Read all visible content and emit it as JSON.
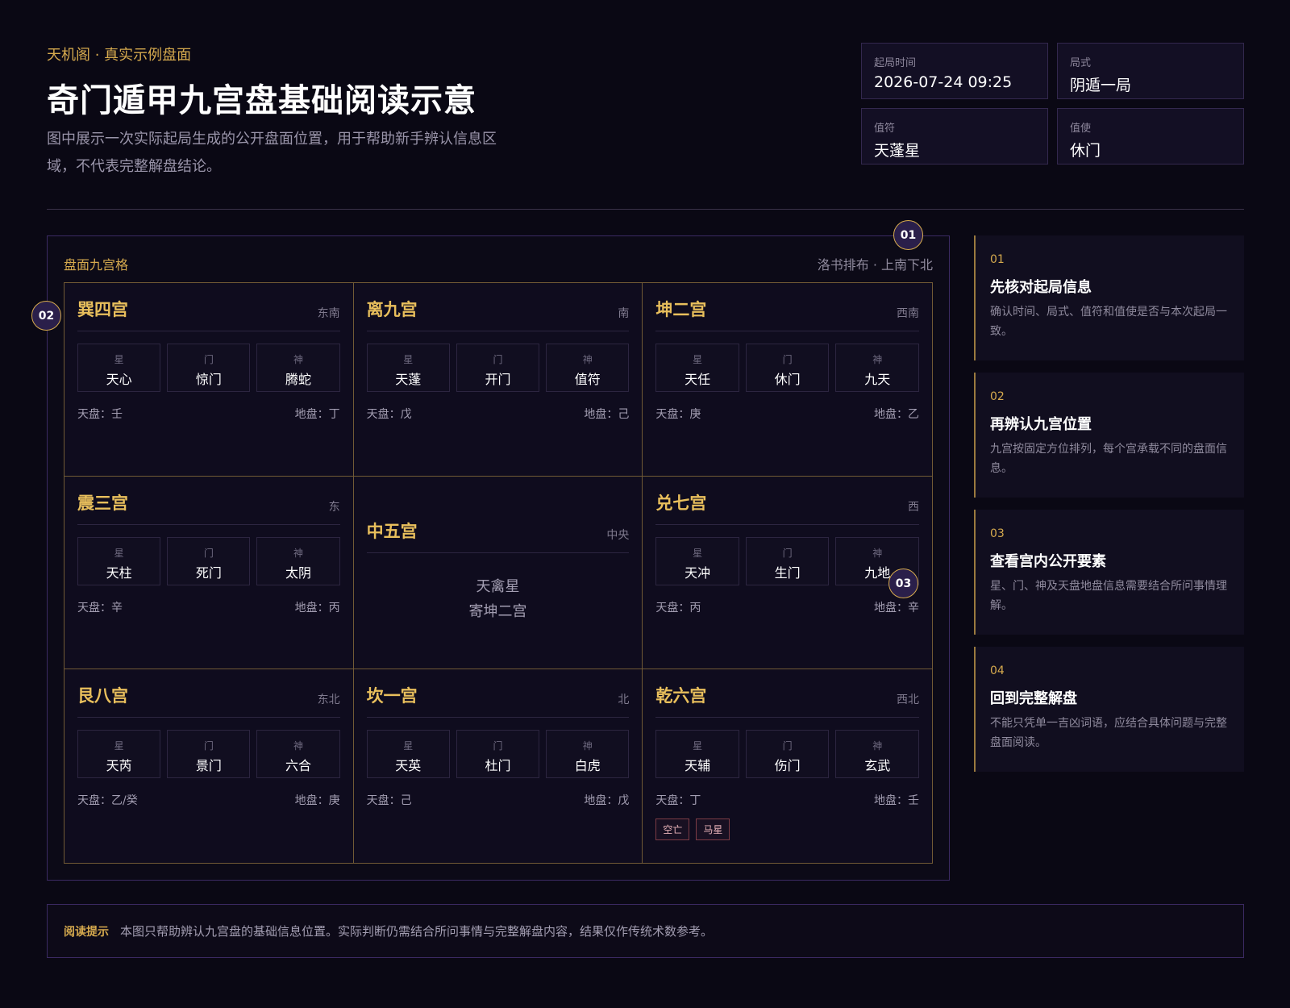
{
  "header": {
    "kicker": "天机阁 · 真实示例盘面",
    "title": "奇门遁甲九宫盘基础阅读示意",
    "subtitle": "图中展示一次实际起局生成的公开盘面位置，用于帮助新手辨认信息区域，不代表完整解盘结论。"
  },
  "meta": [
    {
      "label": "起局时间",
      "value": "2026-07-24 09:25"
    },
    {
      "label": "局式",
      "value": "阴遁一局"
    },
    {
      "label": "值符",
      "value": "天蓬星"
    },
    {
      "label": "值使",
      "value": "休门"
    }
  ],
  "board": {
    "title": "盘面九宫格",
    "layout": "洛书排布 · 上南下北",
    "labels": {
      "star": "星",
      "gate": "门",
      "god": "神",
      "tian": "天盘：",
      "di": "地盘："
    },
    "palaces": [
      {
        "name": "巽四宫",
        "dir": "东南",
        "star": "天心",
        "gate": "惊门",
        "god": "腾蛇",
        "tian": "壬",
        "di": "丁"
      },
      {
        "name": "离九宫",
        "dir": "南",
        "star": "天蓬",
        "gate": "开门",
        "god": "值符",
        "tian": "戊",
        "di": "己"
      },
      {
        "name": "坤二宫",
        "dir": "西南",
        "star": "天任",
        "gate": "休门",
        "god": "九天",
        "tian": "庚",
        "di": "乙"
      },
      {
        "name": "震三宫",
        "dir": "东",
        "star": "天柱",
        "gate": "死门",
        "god": "太阴",
        "tian": "辛",
        "di": "丙"
      },
      {
        "name": "中五宫",
        "dir": "中央",
        "center_line1": "天禽星",
        "center_line2": "寄坤二宫"
      },
      {
        "name": "兑七宫",
        "dir": "西",
        "star": "天冲",
        "gate": "生门",
        "god": "九地",
        "tian": "丙",
        "di": "辛"
      },
      {
        "name": "艮八宫",
        "dir": "东北",
        "star": "天芮",
        "gate": "景门",
        "god": "六合",
        "tian": "乙/癸",
        "di": "庚"
      },
      {
        "name": "坎一宫",
        "dir": "北",
        "star": "天英",
        "gate": "杜门",
        "god": "白虎",
        "tian": "己",
        "di": "戊"
      },
      {
        "name": "乾六宫",
        "dir": "西北",
        "star": "天辅",
        "gate": "伤门",
        "god": "玄武",
        "tian": "丁",
        "di": "壬",
        "tags": [
          "空亡",
          "马星"
        ]
      }
    ]
  },
  "markers": [
    "01",
    "02",
    "03"
  ],
  "steps": [
    {
      "num": "01",
      "title": "先核对起局信息",
      "desc": "确认时间、局式、值符和值使是否与本次起局一致。"
    },
    {
      "num": "02",
      "title": "再辨认九宫位置",
      "desc": "九宫按固定方位排列，每个宫承载不同的盘面信息。"
    },
    {
      "num": "03",
      "title": "查看宫内公开要素",
      "desc": "星、门、神及天盘地盘信息需要结合所问事情理解。"
    },
    {
      "num": "04",
      "title": "回到完整解盘",
      "desc": "不能只凭单一吉凶词语，应结合具体问题与完整盘面阅读。"
    }
  ],
  "tip": {
    "label": "阅读提示",
    "text": "本图只帮助辨认九宫盘的基础信息位置。实际判断仍需结合所问事情与完整解盘内容，结果仅作传统术数参考。"
  }
}
